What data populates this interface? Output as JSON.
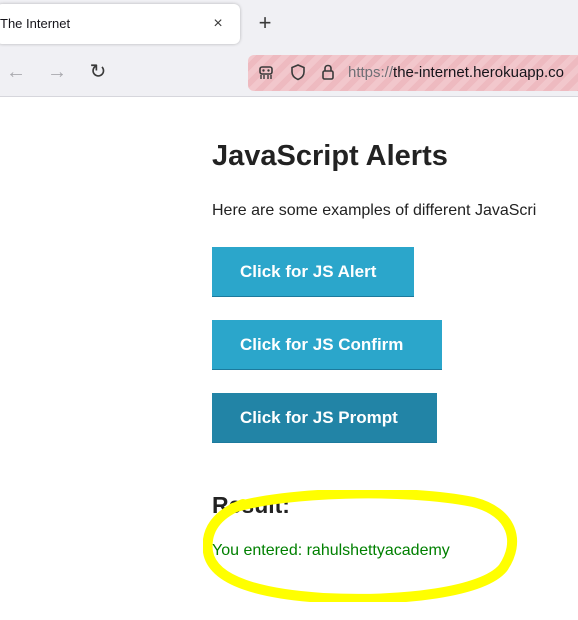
{
  "browser": {
    "tab_title": "The Internet",
    "tab_close_glyph": "×",
    "new_tab_glyph": "+",
    "back_glyph": "←",
    "forward_glyph": "→",
    "reload_glyph": "↻",
    "url_protocol": "https://",
    "url_host": "the-internet.herokuapp.co",
    "url_icons": [
      "tracking-icon",
      "shield-icon",
      "lock-icon"
    ]
  },
  "page": {
    "title": "JavaScript Alerts",
    "description": "Here are some examples of different JavaScri",
    "buttons": {
      "alert_label": "Click for JS Alert",
      "confirm_label": "Click for JS Confirm",
      "prompt_label": "Click for JS Prompt"
    },
    "result_heading": "Result:",
    "result_text": "You entered: rahulshettyacademy"
  },
  "colors": {
    "button": "#2ba6cb",
    "button_active": "#2284a6",
    "result_text": "#008000",
    "highlight_annotation": "#ffff00",
    "private_urlbar": "#f2c7cc"
  }
}
